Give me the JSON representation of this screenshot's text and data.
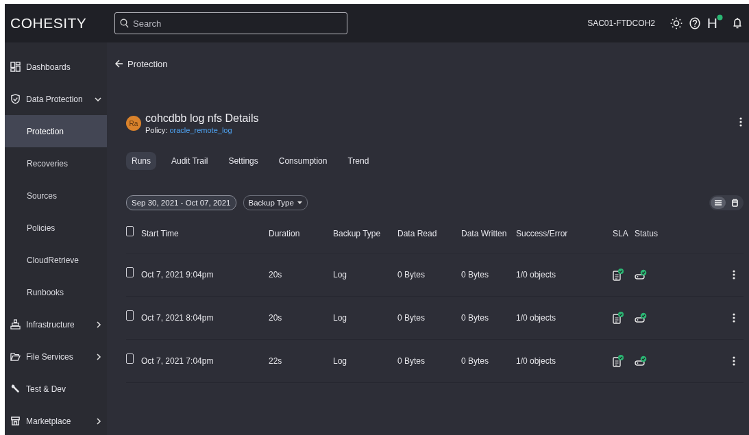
{
  "header": {
    "logo": "COHESITY",
    "search": {
      "placeholder": "Search"
    },
    "cluster": "SAC01-FTDCOH2",
    "user_initial": "H"
  },
  "nav": [
    {
      "label": "Dashboards",
      "kind": "link"
    },
    {
      "label": "Data Protection",
      "kind": "group",
      "expanded": true,
      "children": [
        {
          "label": "Protection",
          "selected": true
        },
        {
          "label": "Recoveries",
          "selected": false
        },
        {
          "label": "Sources",
          "selected": false
        },
        {
          "label": "Policies",
          "selected": false
        },
        {
          "label": "CloudRetrieve",
          "selected": false
        },
        {
          "label": "Runbooks",
          "selected": false
        }
      ]
    },
    {
      "label": "Infrastructure",
      "kind": "group",
      "expanded": false
    },
    {
      "label": "File Services",
      "kind": "group",
      "expanded": false
    },
    {
      "label": "Test & Dev",
      "kind": "link"
    },
    {
      "label": "Marketplace",
      "kind": "group",
      "expanded": false
    }
  ],
  "breadcrumb": "Protection",
  "details": {
    "avatar": "Ra",
    "title": "cohcdbb log nfs Details",
    "policy_label": "Policy:",
    "policy": "oracle_remote_log"
  },
  "tabs": [
    {
      "label": "Runs",
      "selected": true
    },
    {
      "label": "Audit Trail",
      "selected": false
    },
    {
      "label": "Settings",
      "selected": false
    },
    {
      "label": "Consumption",
      "selected": false
    },
    {
      "label": "Trend",
      "selected": false
    }
  ],
  "filters": {
    "date_range": "Sep 30, 2021 - Oct 07, 2021",
    "backup_type": "Backup Type"
  },
  "view_toggle": [
    {
      "kind": "list",
      "selected": true
    },
    {
      "kind": "calendar",
      "selected": false
    }
  ],
  "table": {
    "select_all_checked": false,
    "columns": [
      "Start Time",
      "Duration",
      "Backup Type",
      "Data Read",
      "Data Written",
      "Success/Error",
      "SLA",
      "Status"
    ],
    "rows": [
      {
        "checked": false,
        "start_time": "Oct 7, 2021 9:04pm",
        "duration": "20s",
        "backup_type": "Log",
        "data_read": "0 Bytes",
        "data_written": "0 Bytes",
        "success_error": "1/0 objects",
        "sla_met": true,
        "status_ok": true
      },
      {
        "checked": false,
        "start_time": "Oct 7, 2021 8:04pm",
        "duration": "20s",
        "backup_type": "Log",
        "data_read": "0 Bytes",
        "data_written": "0 Bytes",
        "success_error": "1/0 objects",
        "sla_met": true,
        "status_ok": true
      },
      {
        "checked": false,
        "start_time": "Oct 7, 2021 7:04pm",
        "duration": "22s",
        "backup_type": "Log",
        "data_read": "0 Bytes",
        "data_written": "0 Bytes",
        "success_error": "1/0 objects",
        "sla_met": true,
        "status_ok": true
      }
    ]
  }
}
